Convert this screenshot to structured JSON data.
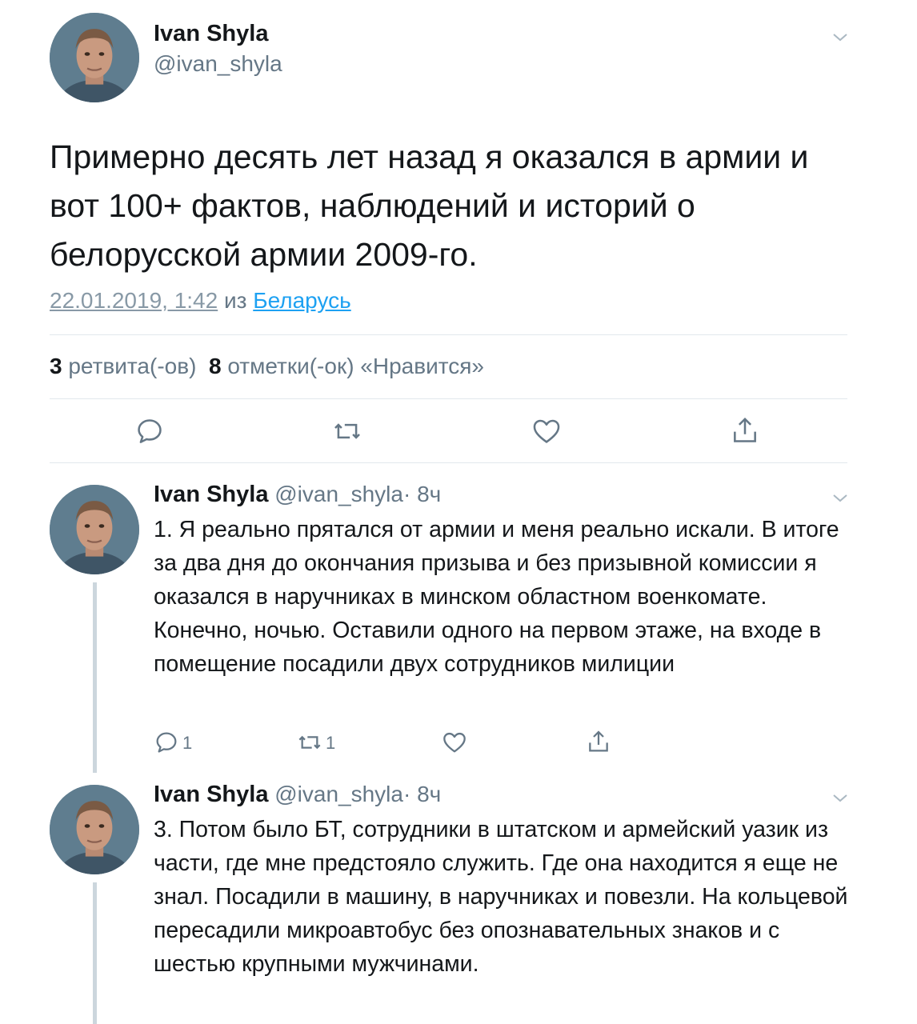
{
  "main_tweet": {
    "author_name": "Ivan Shyla",
    "author_handle": "@ivan_shyla",
    "text": "Примерно десять лет назад я оказался в армии и вот 100+ фактов, наблюдений и историй о белорусской армии 2009-го.",
    "date": "22.01.2019, 1:42",
    "from_label": "из",
    "location": "Беларусь",
    "retweet_count": "3",
    "retweet_label": "ретвита(-ов)",
    "like_count": "8",
    "like_label": "отметки(-ок) «Нравится»",
    "actions": [
      "reply-icon",
      "retweet-icon",
      "heart-icon",
      "share-icon"
    ]
  },
  "replies": [
    {
      "author_name": "Ivan Shyla",
      "author_handle": "@ivan_shyla",
      "time": "· 8ч",
      "text": "1. Я реально прятался от армии и меня реально искали. В итоге за два дня до окончания призыва и без призывной комиссии я оказался в наручниках в минском областном военкомате. Конечно, ночью. Оставили одного на первом этаже, на входе в помещение посадили двух сотрудников милиции",
      "reply_count": "1",
      "retweet_count": "1"
    },
    {
      "author_name": "Ivan Shyla",
      "author_handle": "@ivan_shyla",
      "time": "· 8ч",
      "text": "3. Потом было БТ, сотрудники в штатском и армейский уазик из части, где мне предстояло служить. Где она находится я еще не знал. Посадили в машину, в наручниках и повезли. На кольцевой пересадили микроавтобус без опознавательных знаков и с шестью крупными мужчинами."
    }
  ],
  "colors": {
    "text": "#14171a",
    "secondary": "#657786",
    "link": "#1da1f2",
    "icon": "#657786",
    "divider": "#e1e8ed",
    "thread_line": "#ccd6dd"
  }
}
